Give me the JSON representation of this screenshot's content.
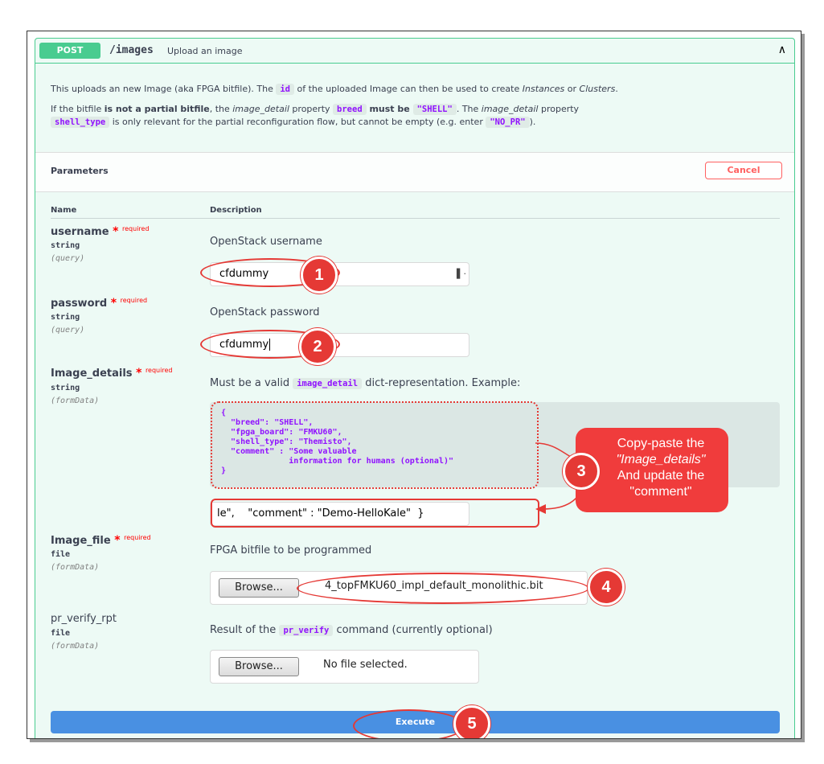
{
  "operation": {
    "method": "POST",
    "path": "/images",
    "summary": "Upload an image"
  },
  "description": {
    "line1_pre": "This uploads an new Image (aka FPGA bitfile). The ",
    "line1_code": "id",
    "line1_mid": " of the uploaded Image can then be used to create ",
    "line1_em1": "Instances",
    "line1_or": " or ",
    "line1_em2": "Clusters",
    "line1_end": ".",
    "line2_pre": "If the bitfile ",
    "line2_bold1": "is not a partial bitfile",
    "line2_a": ", the ",
    "line2_em1": "image_detail",
    "line2_b": " property ",
    "line2_code1": "breed",
    "line2_bold2": " must be ",
    "line2_code2": "\"SHELL\"",
    "line2_c": ". The ",
    "line2_em2": "image_detail",
    "line2_d": " property",
    "line3_code1": "shell_type",
    "line3_a": " is only relevant for the partial reconfiguration flow, but cannot be empty (e.g. enter ",
    "line3_code2": "\"NO_PR\"",
    "line3_end": ")."
  },
  "parameters": {
    "title": "Parameters",
    "cancel_label": "Cancel",
    "col_name": "Name",
    "col_description": "Description",
    "required_mark": "*",
    "required_text": "required",
    "items": [
      {
        "name": "username",
        "type": "string",
        "in": "(query)",
        "description": "OpenStack username",
        "value": "cfdummy"
      },
      {
        "name": "password",
        "type": "string",
        "in": "(query)",
        "description": "OpenStack password",
        "value": "cfdummy"
      },
      {
        "name": "Image_details",
        "type": "string",
        "in": "(formData)",
        "description_pre": "Must be a valid ",
        "description_code": "image_detail",
        "description_post": " dict-representation. Example:",
        "example": "{\n  \"breed\": \"SHELL\",\n  \"fpga_board\": \"FMKU60\",\n  \"shell_type\": \"Themisto\",\n  \"comment\" : \"Some valuable\n              information for humans (optional)\"\n}",
        "value": "le\",    \"comment\" : \"Demo-HelloKale\"  }"
      },
      {
        "name": "Image_file",
        "type": "file",
        "in": "(formData)",
        "description": "FPGA bitfile to be programmed",
        "browse_label": "Browse...",
        "file_name": "4_topFMKU60_impl_default_monolithic.bit"
      },
      {
        "name": "pr_verify_rpt",
        "type": "file",
        "in": "(formData)",
        "description_pre": "Result of the ",
        "description_code": "pr_verify",
        "description_post": " command (currently optional)",
        "browse_label": "Browse...",
        "file_name": "No file selected."
      }
    ]
  },
  "execute_label": "Execute",
  "annotations": {
    "badges": [
      "1",
      "2",
      "3",
      "4",
      "5"
    ],
    "callout_line1": "Copy-paste the",
    "callout_line2": "\"Image_details\"",
    "callout_line3": "And update the",
    "callout_line4": "\"comment\""
  },
  "colors": {
    "post_green": "#49cc90",
    "annotation_red": "#e53935",
    "execute_blue": "#4990e2",
    "code_purple": "#9012fe"
  }
}
